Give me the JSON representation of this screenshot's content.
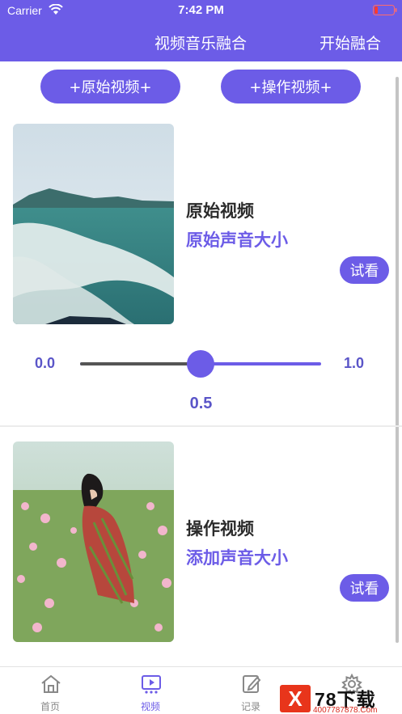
{
  "status_bar": {
    "carrier": "Carrier",
    "time": "7:42 PM"
  },
  "nav": {
    "title": "视频音乐融合",
    "action": "开始融合"
  },
  "buttons": {
    "original_video": "+原始视频+",
    "operate_video": "+操作视频+"
  },
  "cards": [
    {
      "title": "原始视频",
      "subtitle": "原始声音大小",
      "try_label": "试看",
      "image": "sea-boat-wake-photo"
    },
    {
      "title": "操作视频",
      "subtitle": "添加声音大小",
      "try_label": "试看",
      "image": "girl-flower-field-photo"
    }
  ],
  "slider": {
    "min_label": "0.0",
    "max_label": "1.0",
    "value_label": "0.5",
    "value": 0.5
  },
  "tabs": [
    {
      "label": "首页",
      "icon": "home-icon",
      "active": false
    },
    {
      "label": "视频",
      "icon": "video-icon",
      "active": true
    },
    {
      "label": "记录",
      "icon": "edit-icon",
      "active": false
    },
    {
      "label": "",
      "icon": "settings-icon",
      "active": false
    }
  ],
  "watermark": {
    "mark": "X",
    "text": "78下载",
    "url": "4007787878.Com"
  },
  "colors": {
    "accent": "#6c5ce7",
    "text": "#2b2b2b",
    "muted": "#888888"
  }
}
